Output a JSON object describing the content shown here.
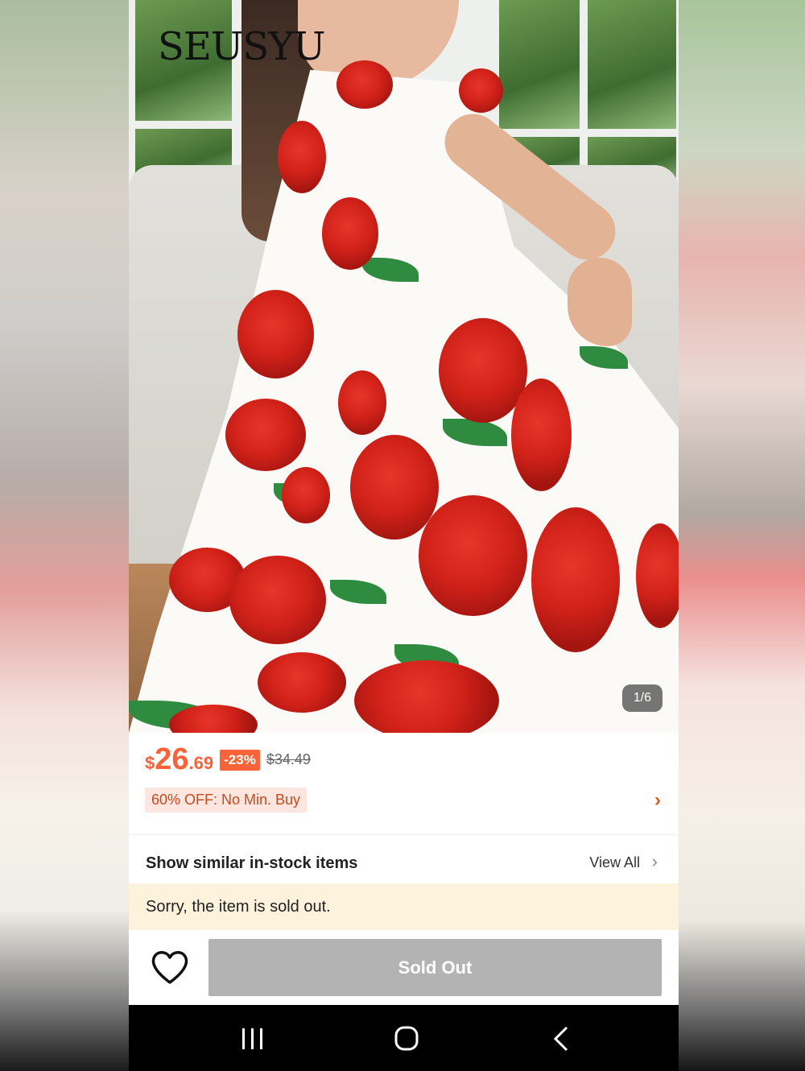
{
  "product": {
    "brand_logo_text": "SEUSYU",
    "image_counter": "1/6",
    "price_currency": "$",
    "price_integer": "26",
    "price_cents": ".69",
    "discount_badge": "-23%",
    "original_price": "$34.49",
    "promo_label": "60% OFF: No Min. Buy"
  },
  "similar": {
    "title": "Show similar in-stock items",
    "view_all": "View All"
  },
  "notice": {
    "sold_out_message": "Sorry, the item is sold out."
  },
  "actions": {
    "sold_out_button": "Sold Out",
    "wishlist_icon": "heart-outline-icon"
  },
  "system_nav": {
    "recents_icon": "recents-icon",
    "home_icon": "home-icon",
    "back_icon": "back-icon"
  },
  "colors": {
    "price_accent": "#fa6338",
    "promo_bg": "#fde6df",
    "notice_bg": "#fdf3dd",
    "disabled_button": "#b3b3b3"
  }
}
